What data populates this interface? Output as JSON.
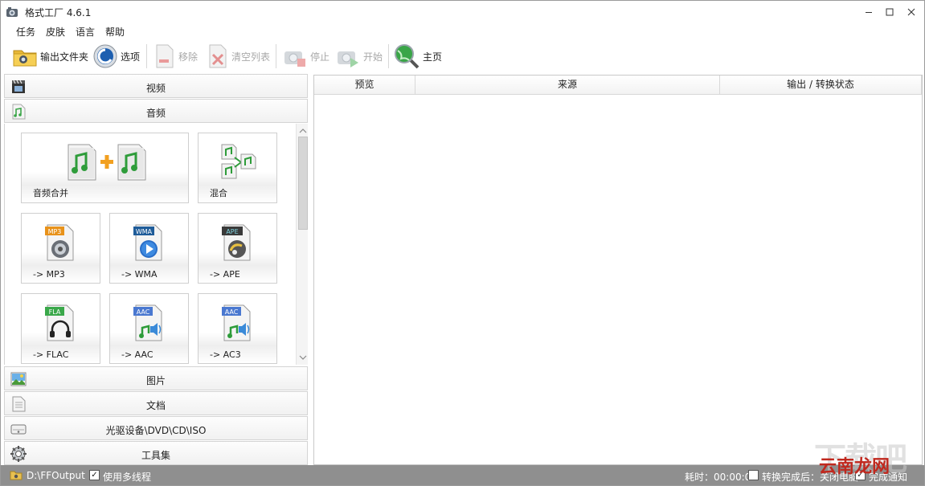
{
  "window": {
    "title": "格式工厂 4.6.1"
  },
  "menu": {
    "items": [
      "任务",
      "皮肤",
      "语言",
      "帮助"
    ]
  },
  "toolbar": {
    "output_folder": "输出文件夹",
    "options": "选项",
    "remove": "移除",
    "clear_list": "清空列表",
    "stop": "停止",
    "start": "开始",
    "home": "主页"
  },
  "left": {
    "categories_top": [
      "视频",
      "音频"
    ],
    "tiles": [
      {
        "label": "音频合并",
        "icon": "audio-merge-icon"
      },
      {
        "label": "混合",
        "icon": "audio-mix-icon"
      },
      {
        "label": "-> MP3",
        "icon": "mp3-file-icon",
        "tag": "MP3",
        "tag_color": "#e8921a"
      },
      {
        "label": "-> WMA",
        "icon": "wma-file-icon",
        "tag": "WMA",
        "tag_color": "#1f5c99"
      },
      {
        "label": "-> APE",
        "icon": "ape-file-icon",
        "tag": "APE",
        "tag_color": "#3a3a3a"
      },
      {
        "label": "-> FLAC",
        "icon": "flac-file-icon",
        "tag": "FLA",
        "tag_color": "#3aa84a"
      },
      {
        "label": "-> AAC",
        "icon": "aac-file-icon",
        "tag": "AAC",
        "tag_color": "#4a78d0"
      },
      {
        "label": "-> AC3",
        "icon": "ac3-file-icon",
        "tag": "AAC",
        "tag_color": "#4a78d0"
      }
    ],
    "categories_bottom": [
      "图片",
      "文档",
      "光驱设备\\DVD\\CD\\ISO",
      "工具集"
    ]
  },
  "table": {
    "columns": [
      "预览",
      "来源",
      "输出 / 转换状态"
    ]
  },
  "status": {
    "output_path": "D:\\FFOutput",
    "multithread_label": "使用多线程",
    "multithread_checked": true,
    "elapsed": "耗时：00:00:00",
    "after_convert": "转换完成后：关闭电脑",
    "after_convert_checked": false,
    "notify_label": "完成通知",
    "notify_checked": true
  },
  "watermark": {
    "text_big": "下载吧",
    "text_small": "云南龙网"
  },
  "colors": {
    "statusbar": "#8f8f8f",
    "accent_green": "#2e9c3a",
    "watermark_red": "#c0281e"
  }
}
